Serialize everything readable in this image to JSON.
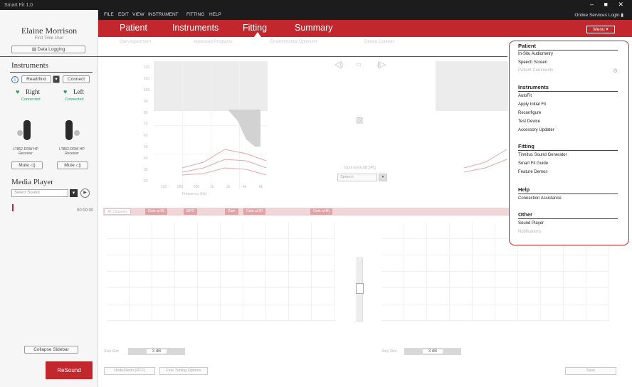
{
  "window": {
    "title": "Smart Fit 1.0",
    "controls": "– ■ ✕"
  },
  "sidebar": {
    "patient_name": "Elaine Morrison",
    "patient_sub": "First Time User",
    "data_logging_btn": "Data Logging",
    "instruments_title": "Instruments",
    "readfind_btn": "Read/find",
    "connect_btn": "Connect",
    "right_label": "Right",
    "left_label": "Left",
    "right_status": "Connected",
    "left_status": "Connected",
    "right_model": "LT862-DRW HP Receiver",
    "left_model": "LT862-DRW HP Receiver",
    "mute_right": "Mute",
    "mute_left": "Mute",
    "media_title": "Media Player",
    "media_placeholder": "Select Sound",
    "time": "00:00:00",
    "collapse_btn": "Collapse Sidebar",
    "logo": "ReSound"
  },
  "menubar": {
    "items": [
      "FILE",
      "EDIT",
      "VIEW",
      "INSTRUMENT",
      "FITTING",
      "HELP"
    ],
    "login": "Online Services Login"
  },
  "nav": {
    "tabs": [
      "Patient",
      "Instruments",
      "Fitting",
      "Summary"
    ],
    "menu_btn": "Menu ▾"
  },
  "subtabs": [
    "Gain Adjustment",
    "Advanced Programs",
    "Environmental Optimizer",
    "Device Controls"
  ],
  "graph": {
    "yticks": [
      "120",
      "110",
      "100",
      "90",
      "80",
      "70",
      "60",
      "50",
      "40",
      "30",
      "20"
    ],
    "xticks": [
      "125",
      "250",
      "500",
      "1k",
      "2k",
      "4k",
      "8k"
    ],
    "xlabel": "Frequency (Hz)",
    "center_select": "Speech",
    "center_label": "Input level (dB SPL)"
  },
  "fine_tuning": {
    "chips": [
      "All Channels",
      "Gain at 65",
      "MPO",
      "Gain",
      "Gain at 50",
      "Gain at 80"
    ],
    "left_step_label": "Step Size",
    "left_step_value": "3 dB",
    "right_step_label": "Step Size",
    "right_step_value": "3 dB",
    "bottom_btns": [
      "Undo/Redo (RTF)",
      "Fine Tuning Options"
    ],
    "save_btn": "Save"
  },
  "dropdown": {
    "sections": [
      {
        "title": "Patient",
        "items": [
          {
            "label": "In-Situ Audiometry",
            "disabled": false
          },
          {
            "label": "Speech Screen",
            "disabled": false
          },
          {
            "label": "Patient Comments",
            "disabled": true
          }
        ]
      },
      {
        "title": "Instruments",
        "items": [
          {
            "label": "AutoFit",
            "disabled": false
          },
          {
            "label": "Apply Initial Fit",
            "disabled": false
          },
          {
            "label": "Reconfigure",
            "disabled": false
          },
          {
            "label": "Test Device",
            "disabled": false
          },
          {
            "label": "Accessory Updater",
            "disabled": false
          }
        ]
      },
      {
        "title": "Fitting",
        "items": [
          {
            "label": "Tinnitus Sound Generator",
            "disabled": false
          },
          {
            "label": "Smart Fit Guide",
            "disabled": false
          },
          {
            "label": "Feature Demos",
            "disabled": false
          }
        ]
      },
      {
        "title": "Help",
        "items": [
          {
            "label": "Connection Assistance",
            "disabled": false
          }
        ]
      },
      {
        "title": "Other",
        "items": [
          {
            "label": "Sound Player",
            "disabled": false
          },
          {
            "label": "Notifications",
            "disabled": true
          }
        ]
      }
    ]
  },
  "colors": {
    "brand_red": "#c1272d",
    "dark_bar": "#1c1c1c",
    "connected_green": "#2a9a6a"
  }
}
